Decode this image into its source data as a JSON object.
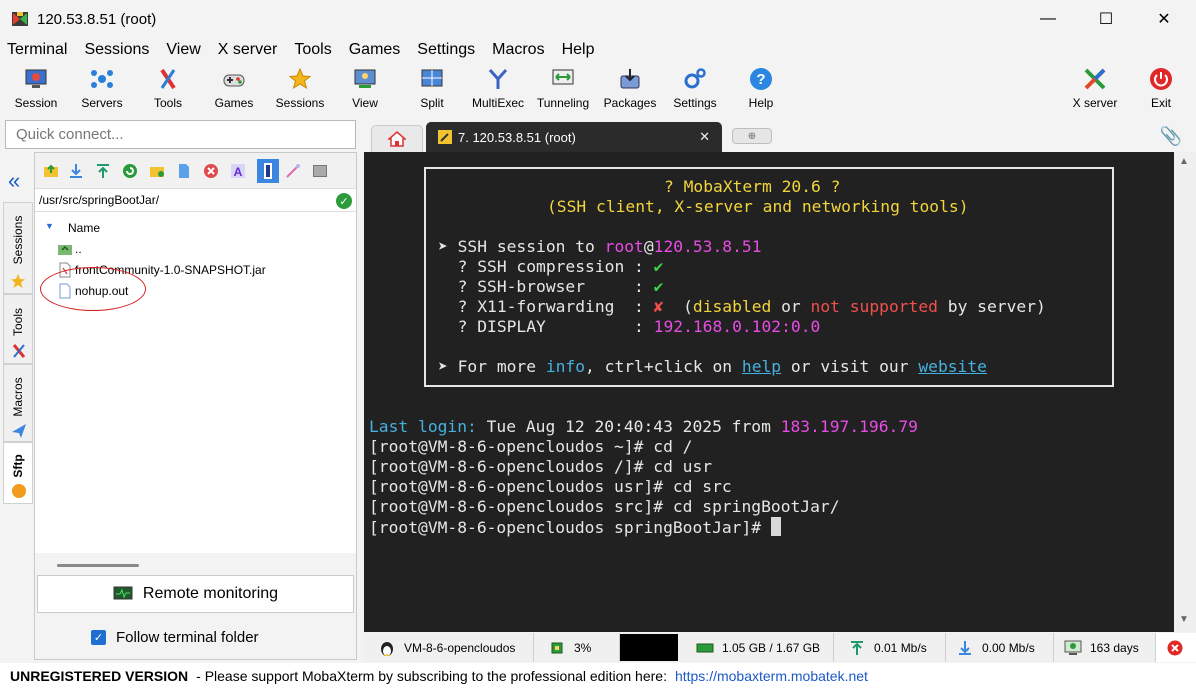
{
  "window": {
    "title": "120.53.8.51 (root)",
    "minimize": "—",
    "maximize": "☐",
    "close": "✕"
  },
  "menu": [
    "Terminal",
    "Sessions",
    "View",
    "X server",
    "Tools",
    "Games",
    "Settings",
    "Macros",
    "Help"
  ],
  "toolbar": {
    "session": "Session",
    "servers": "Servers",
    "tools": "Tools",
    "games": "Games",
    "sessions": "Sessions",
    "view": "View",
    "split": "Split",
    "multiexec": "MultiExec",
    "tunneling": "Tunneling",
    "packages": "Packages",
    "settings": "Settings",
    "help": "Help",
    "xserver": "X server",
    "exit": "Exit"
  },
  "quick_connect": {
    "placeholder": "Quick connect..."
  },
  "tabs": {
    "session_tab": "7. 120.53.8.51 (root)",
    "close": "✕"
  },
  "sidebar": {
    "sessions": "Sessions",
    "tools": "Tools",
    "macros": "Macros",
    "sftp": "Sftp",
    "collapse": "«"
  },
  "sftp": {
    "path": "/usr/src/springBootJar/",
    "column_name": "Name",
    "files": [
      "..",
      "frontCommunity-1.0-SNAPSHOT.jar",
      "nohup.out"
    ],
    "remote_monitoring": "Remote monitoring",
    "follow_terminal": "Follow terminal folder"
  },
  "terminal": {
    "banner_title": "? MobaXterm 20.6 ?",
    "banner_subtitle": "(SSH client, X-server and networking tools)",
    "ssh_session_prefix": "➤ SSH session to ",
    "ssh_user": "root",
    "ssh_at": "@",
    "ssh_host": "120.53.8.51",
    "compression": "  ? SSH compression : ",
    "browser": "  ? SSH-browser     : ",
    "x11": "  ? X11-forwarding  : ",
    "display": "  ? DISPLAY         : ",
    "check": "✔",
    "cross": "✘",
    "x11_paren_open": "  (",
    "x11_disabled": "disabled",
    "x11_or": " or ",
    "x11_not_supported": "not supported",
    "x11_by_server": " by server)",
    "display_value": "192.168.0.102:0.0",
    "more_prefix": "➤ For more ",
    "more_info": "info",
    "more_mid": ", ctrl+click on ",
    "more_help": "help",
    "more_or": " or visit our ",
    "more_website": "website",
    "last_login_label": "Last login:",
    "last_login_text": " Tue Aug 12 20:40:43 2025 from ",
    "last_login_ip": "183.197.196.79",
    "lines": [
      "[root@VM-8-6-opencloudos ~]# cd /",
      "[root@VM-8-6-opencloudos /]# cd usr",
      "[root@VM-8-6-opencloudos usr]# cd src",
      "[root@VM-8-6-opencloudos src]# cd springBootJar/",
      "[root@VM-8-6-opencloudos springBootJar]# "
    ]
  },
  "status": {
    "hostname": "VM-8-6-opencloudos",
    "cpu": "3%",
    "memory": "1.05 GB / 1.67 GB",
    "upload": "0.01 Mb/s",
    "download": "0.00 Mb/s",
    "uptime": "163 days"
  },
  "footer": {
    "unregistered": "UNREGISTERED VERSION",
    "message": " -  Please support MobaXterm by subscribing to the professional edition here:",
    "url": "https://mobaxterm.mobatek.net"
  },
  "colors": {
    "terminal_bg": "#212121",
    "accent_blue": "#1f6fd1",
    "exit_red": "#e02828"
  }
}
